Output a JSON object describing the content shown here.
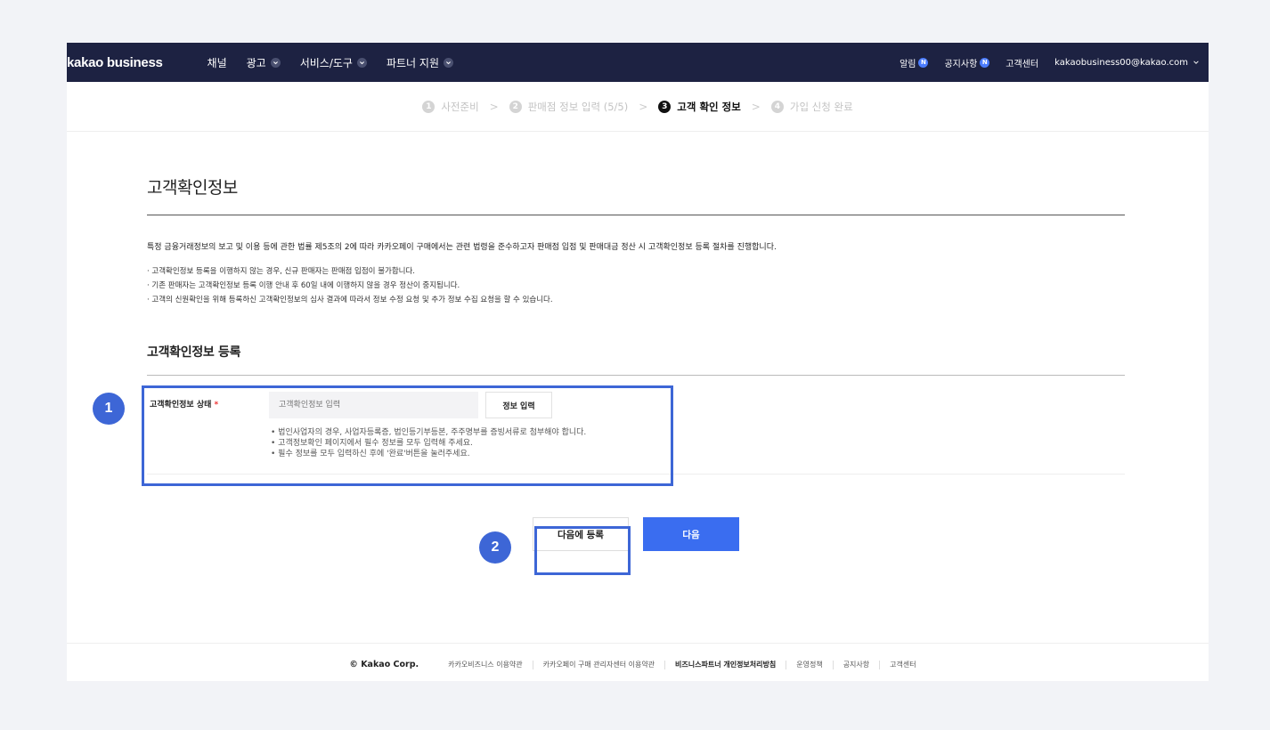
{
  "nav": {
    "logo": "kakao business",
    "menu": [
      {
        "label": "채널",
        "has_chevron": false
      },
      {
        "label": "광고",
        "has_chevron": true
      },
      {
        "label": "서비스/도구",
        "has_chevron": true
      },
      {
        "label": "파트너 지원",
        "has_chevron": true
      }
    ],
    "alarm": "알림",
    "notice": "공지사항",
    "badge": "N",
    "support": "고객센터",
    "account": "kakaobusiness00@kakao.com"
  },
  "steps": [
    {
      "num": "1",
      "label": "사전준비"
    },
    {
      "num": "2",
      "label": "판매점 정보 입력 (5/5)"
    },
    {
      "num": "3",
      "label": "고객 확인 정보"
    },
    {
      "num": "4",
      "label": "가입 신청 완료"
    }
  ],
  "steps_separator": ">",
  "page": {
    "title": "고객확인정보",
    "description": "특정 금융거래정보의 보고 및 이용 등에 관한 법률 제5조의 2에 따라 카카오페이 구매에서는 관련 법령을 준수하고자 판매점 입점 및 판매대금 정산 시 고객확인정보 등록 절차를 진행합니다.",
    "notes": [
      "· 고객확인정보 등록을 이행하지 않는 경우, 신규 판매자는 판매점 입점이 불가합니다.",
      "· 기존 판매자는 고객확인정보 등록 이행 안내 후 60일 내에 이행하지 않을 경우 정산이 중지됩니다.",
      "· 고객의 신원확인을 위해 등록하신 고객확인정보의 심사 결과에 따라서 정보 수정 요청 및 추가 정보 수집 요청을 할 수 있습니다."
    ],
    "section_title": "고객확인정보 등록"
  },
  "form": {
    "label": "고객확인정보 상태",
    "required_mark": "*",
    "placeholder": "고객확인정보 입력",
    "button": "정보 입력",
    "help": [
      "• 법인사업자의 경우, 사업자등록증, 법인등기부등본, 주주명부를 증빙서류로 첨부해야 합니다.",
      "• 고객정보확인 페이지에서 필수 정보를 모두 입력해 주세요.",
      "• 필수 정보를 모두 입력하신 후에 '완료'버튼을 눌러주세요."
    ]
  },
  "buttons": {
    "later": "다음에 등록",
    "next": "다음"
  },
  "footer": {
    "corp": "© Kakao Corp.",
    "links": [
      {
        "label": "카카오비즈니스 이용약관",
        "bold": false
      },
      {
        "label": "카카오페이 구매 관리자센터 이용약관",
        "bold": false
      },
      {
        "label": "비즈니스파트너 개인정보처리방침",
        "bold": true
      },
      {
        "label": "운영정책",
        "bold": false
      },
      {
        "label": "공지사항",
        "bold": false
      },
      {
        "label": "고객센터",
        "bold": false
      }
    ]
  },
  "annotations": [
    "1",
    "2"
  ],
  "colors": {
    "nav_bg": "#1d2242",
    "primary": "#3a6df0",
    "annotation": "#3d66d6",
    "badge": "#4c7dff",
    "required": "#e33333"
  }
}
